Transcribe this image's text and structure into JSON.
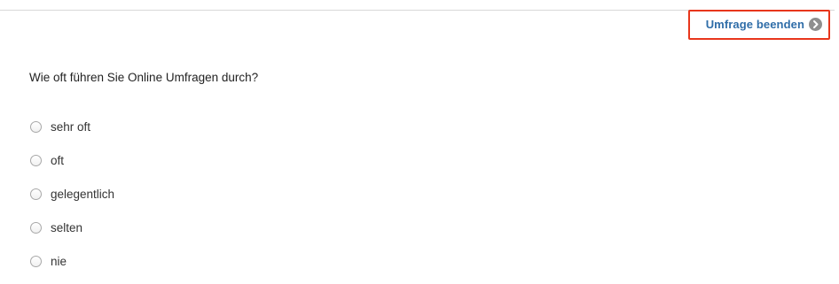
{
  "header": {
    "end_survey_label": "Umfrage beenden",
    "end_survey_icon": "arrow-right-circle-icon",
    "highlight_color": "#e8361c",
    "link_color": "#2f6da8"
  },
  "question": {
    "text": "Wie oft führen Sie Online Umfragen durch?",
    "options": [
      {
        "label": "sehr oft",
        "selected": false
      },
      {
        "label": "oft",
        "selected": false
      },
      {
        "label": "gelegentlich",
        "selected": false
      },
      {
        "label": "selten",
        "selected": false
      },
      {
        "label": "nie",
        "selected": false
      }
    ]
  }
}
